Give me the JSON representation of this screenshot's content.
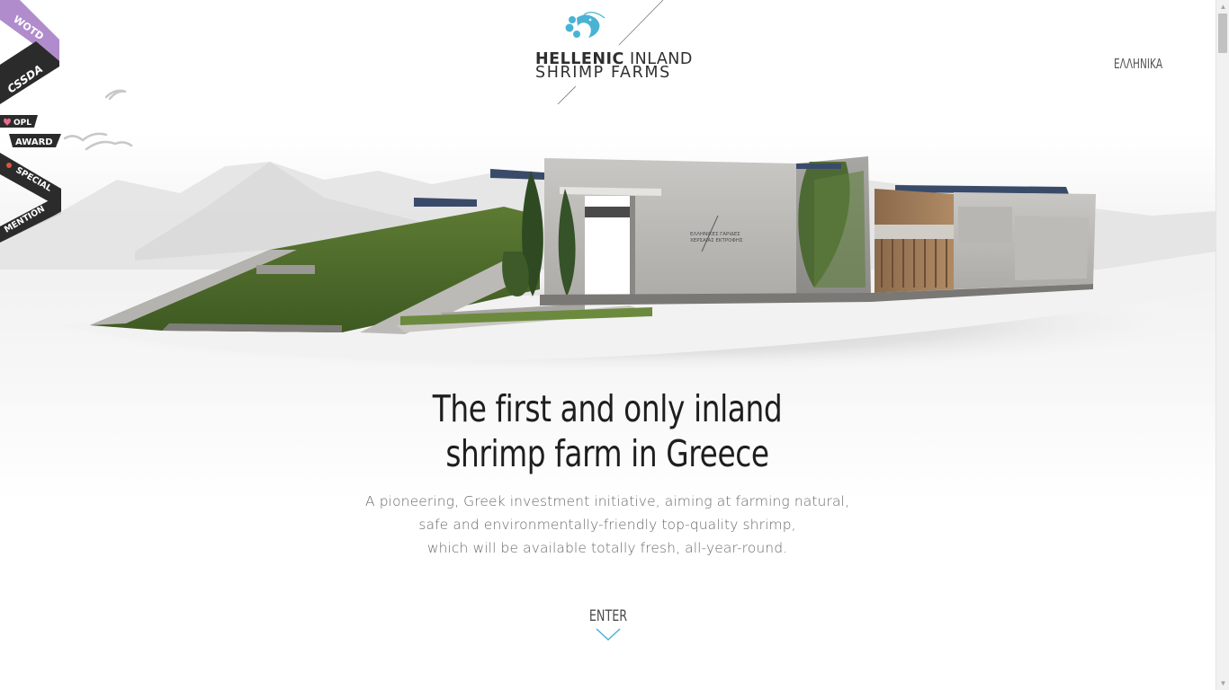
{
  "logo": {
    "line1_bold": "HELLENIC",
    "line1_regular": "INLAND",
    "line2": "SHRIMP FARMS"
  },
  "nav": {
    "language_link": "ΕΛΛΗΝΙΚΑ"
  },
  "ribbons": {
    "wotd": "WOTD",
    "cssda": "CSSDA",
    "opl": "OPL",
    "award": "AWARD",
    "special": "SPECIAL",
    "mention": "MENTION"
  },
  "building": {
    "sign_line1": "ΕΛΛΗΝΙΚΕΣ ΓΑΡΙΔΕΣ",
    "sign_line2": "ΧΕΡΣΑΙΑΣ ΕΚΤΡΟΦΗΣ"
  },
  "hero": {
    "headline_line1": "The first and only inland",
    "headline_line2": "shrimp farm in Greece",
    "sub_line1": "A pioneering, Greek investment initiative, aiming at farming natural,",
    "sub_line2": "safe and environmentally-friendly top-quality shrimp,",
    "sub_line3": "which will be available totally fresh, all-year-round."
  },
  "enter": {
    "label": "ENTER",
    "icon": "chevron-down-icon"
  },
  "colors": {
    "accent": "#4ab3d4",
    "wotd_ribbon": "#b08ccc",
    "dark_ribbon": "#2b2b2b",
    "text_dark": "#1e1e1e",
    "text_muted": "#6a6a6a"
  }
}
